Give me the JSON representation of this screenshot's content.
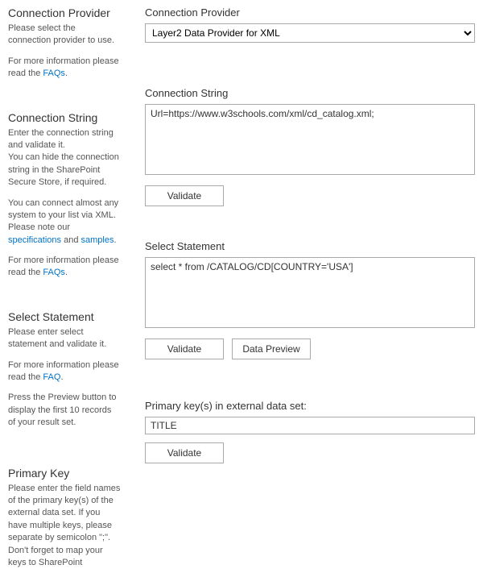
{
  "left": {
    "provider": {
      "heading": "Connection Provider",
      "p1": "Please select the connection provider to use.",
      "p2_prefix": "For more information please read the ",
      "p2_link": "FAQs",
      "p2_suffix": "."
    },
    "connstring": {
      "heading": "Connection String",
      "p1": "Enter the connection string and validate it.",
      "p2": "You can hide the connection string in the SharePoint Secure Store, if required.",
      "p3_prefix": "You can connect almost any system to your list via XML. Please note our ",
      "p3_link1": "specifications",
      "p3_mid": " and ",
      "p3_link2": "samples",
      "p3_suffix": ".",
      "p4_prefix": "For more information please read the ",
      "p4_link": "FAQs",
      "p4_suffix": "."
    },
    "select": {
      "heading": "Select Statement",
      "p1": "Please enter select statement and validate it.",
      "p2_prefix": "For more information please read the ",
      "p2_link": "FAQ",
      "p2_suffix": ".",
      "p3": "Press the Preview button to display the first 10 records of your result set."
    },
    "primary": {
      "heading": "Primary Key",
      "p1": "Please enter the field names of the primary key(s) of the external data set. If you have multiple keys, please separate by semicolon \";\". Don't forget to map your keys to SharePoint"
    }
  },
  "right": {
    "provider": {
      "label": "Connection Provider",
      "value": "Layer2 Data Provider for XML"
    },
    "connstring": {
      "label": "Connection String",
      "value": "Url=https://www.w3schools.com/xml/cd_catalog.xml;",
      "validate_label": "Validate"
    },
    "select": {
      "label": "Select Statement",
      "value": "select * from /CATALOG/CD[COUNTRY='USA']",
      "validate_label": "Validate",
      "preview_label": "Data Preview"
    },
    "primary": {
      "label": "Primary key(s) in external data set:",
      "value": "TITLE",
      "validate_label": "Validate"
    }
  }
}
